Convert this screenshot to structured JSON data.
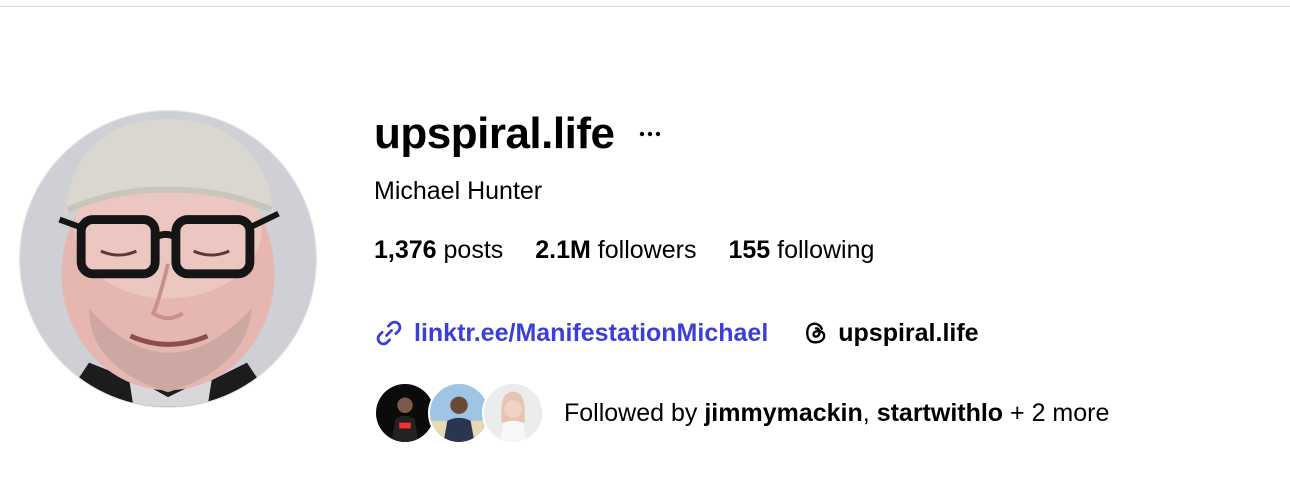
{
  "profile": {
    "username": "upspiral.life",
    "display_name": "Michael Hunter",
    "more_label": "···",
    "avatar_icon": "profile-photo"
  },
  "stats": {
    "posts_count": "1,376",
    "posts_label": " posts",
    "followers_count": "2.1M",
    "followers_label": " followers",
    "following_count": "155",
    "following_label": " following"
  },
  "links": {
    "website_icon": "link-icon",
    "website_text": "linktr.ee/ManifestationMichael",
    "threads_icon": "threads-icon",
    "threads_text": "upspiral.life"
  },
  "followed_by": {
    "prefix": "Followed by ",
    "user1": "jimmymackin",
    "separator": ", ",
    "user2": "startwithlo",
    "suffix": " + 2 more"
  },
  "colors": {
    "link": "#3a3fd9",
    "text": "#000000",
    "divider": "#dbdbdb"
  }
}
